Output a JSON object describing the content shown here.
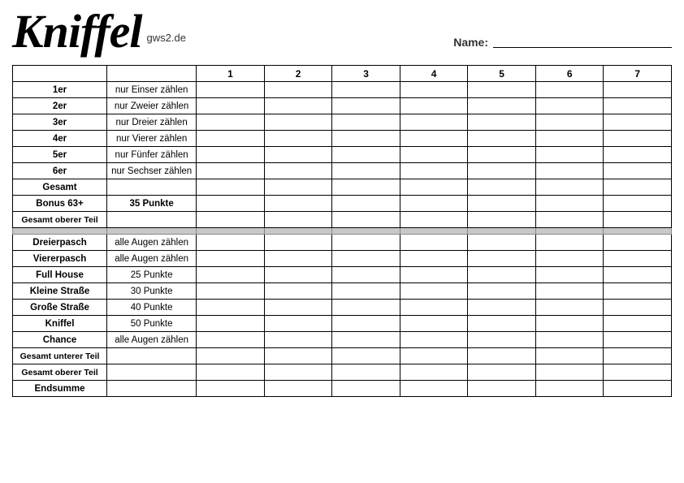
{
  "header": {
    "logo": "Kniffel",
    "subtitle": "gws2.de",
    "name_label": "Name:",
    "name_value": ""
  },
  "columns": {
    "header": [
      "1",
      "2",
      "3",
      "4",
      "5",
      "6",
      "7"
    ]
  },
  "upper_section": {
    "rows": [
      {
        "label": "1er",
        "desc": "nur Einser zählen"
      },
      {
        "label": "2er",
        "desc": "nur Zweier zählen"
      },
      {
        "label": "3er",
        "desc": "nur Dreier zählen"
      },
      {
        "label": "4er",
        "desc": "nur Vierer zählen"
      },
      {
        "label": "5er",
        "desc": "nur Fünfer zählen"
      },
      {
        "label": "6er",
        "desc": "nur Sechser zählen"
      }
    ],
    "gesamt": "Gesamt",
    "bonus_label": "Bonus 63+",
    "bonus_desc": "35 Punkte",
    "gesamt_oberer": "Gesamt oberer Teil"
  },
  "lower_section": {
    "rows": [
      {
        "label": "Dreierpasch",
        "desc": "alle Augen zählen"
      },
      {
        "label": "Viererpasch",
        "desc": "alle Augen zählen"
      },
      {
        "label": "Full House",
        "desc": "25 Punkte"
      },
      {
        "label": "Kleine Straße",
        "desc": "30 Punkte"
      },
      {
        "label": "Große Straße",
        "desc": "40 Punkte"
      },
      {
        "label": "Kniffel",
        "desc": "50 Punkte"
      },
      {
        "label": "Chance",
        "desc": "alle Augen zählen"
      }
    ],
    "gesamt_unterer": "Gesamt unterer Teil",
    "gesamt_oberer": "Gesamt oberer Teil",
    "endsumme": "Endsumme"
  }
}
